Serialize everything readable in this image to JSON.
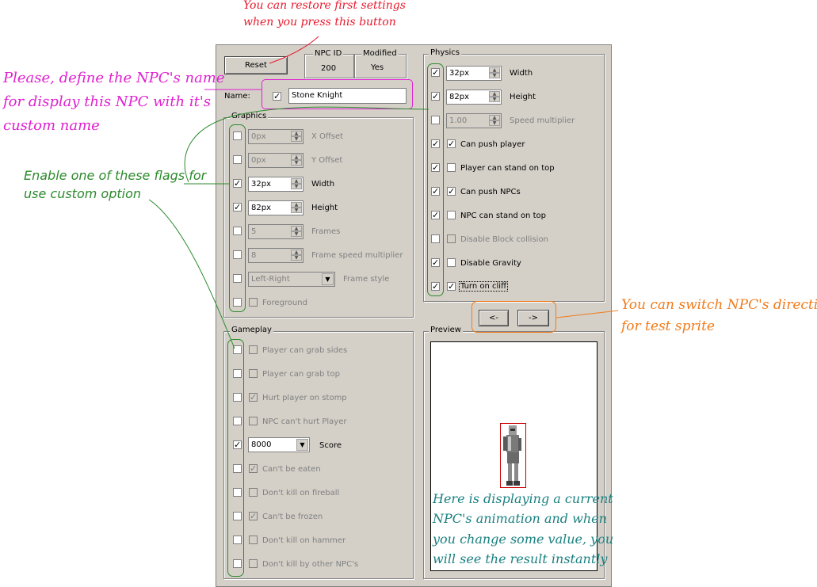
{
  "colors": {
    "panel": "#d4d0c8",
    "red_note": "#e8192c",
    "magenta_note": "#e020d0",
    "green_note": "#2d8a2d",
    "orange_note": "#f07b1a",
    "teal_note": "#1a8080"
  },
  "top": {
    "reset_label": "Reset",
    "npc_id_title": "NPC ID",
    "npc_id_value": "200",
    "modified_title": "Modified",
    "modified_value": "Yes",
    "name_label": "Name:",
    "name_value": "Stone Knight"
  },
  "graphics": {
    "title": "Graphics",
    "rows": [
      {
        "value": "0px",
        "label": "X Offset"
      },
      {
        "value": "0px",
        "label": "Y Offset"
      },
      {
        "value": "32px",
        "label": "Width"
      },
      {
        "value": "82px",
        "label": "Height"
      },
      {
        "value": "5",
        "label": "Frames"
      },
      {
        "value": "8",
        "label": "Frame speed multiplier"
      },
      {
        "value": "Left-Right",
        "label": "Frame style"
      },
      {
        "label": "Foreground"
      }
    ]
  },
  "physics": {
    "title": "Physics",
    "rows": [
      {
        "value": "32px",
        "label": "Width"
      },
      {
        "value": "82px",
        "label": "Height"
      },
      {
        "value": "1.00",
        "label": "Speed multiplier"
      },
      {
        "label": "Can push player"
      },
      {
        "label": "Player can stand on top"
      },
      {
        "label": "Can push NPCs"
      },
      {
        "label": "NPC can stand on top"
      },
      {
        "label": "Disable Block collision"
      },
      {
        "label": "Disable Gravity"
      },
      {
        "label": "Turn on cliff"
      }
    ]
  },
  "gameplay": {
    "title": "Gameplay",
    "rows": [
      {
        "label": "Player can grab sides"
      },
      {
        "label": "Player can grab top"
      },
      {
        "label": "Hurt player on stomp"
      },
      {
        "label": "NPC can't hurt Player"
      },
      {
        "value": "8000",
        "label": "Score"
      },
      {
        "label": "Can't be eaten"
      },
      {
        "label": "Don't kill on fireball"
      },
      {
        "label": "Can't be frozen"
      },
      {
        "label": "Don't kill on hammer"
      },
      {
        "label": "Don't kill by other NPC's"
      }
    ]
  },
  "direction": {
    "left_label": "<-",
    "right_label": "->"
  },
  "preview": {
    "title": "Preview"
  },
  "notes": {
    "reset_1": "You can restore first settings",
    "reset_2": "when you press this button",
    "name_1": "Please, define the NPC's name",
    "name_2": "for display this NPC with it's",
    "name_3": "custom name",
    "flags_1": "Enable one of these flags for",
    "flags_2": "use custom option",
    "dir_1": "You can switch NPC's direction",
    "dir_2": "for test sprite",
    "prev_1": "Here is displaying a current",
    "prev_2": "NPC's animation and when",
    "prev_3": "you change some value, you",
    "prev_4": "will see the result instantly"
  }
}
